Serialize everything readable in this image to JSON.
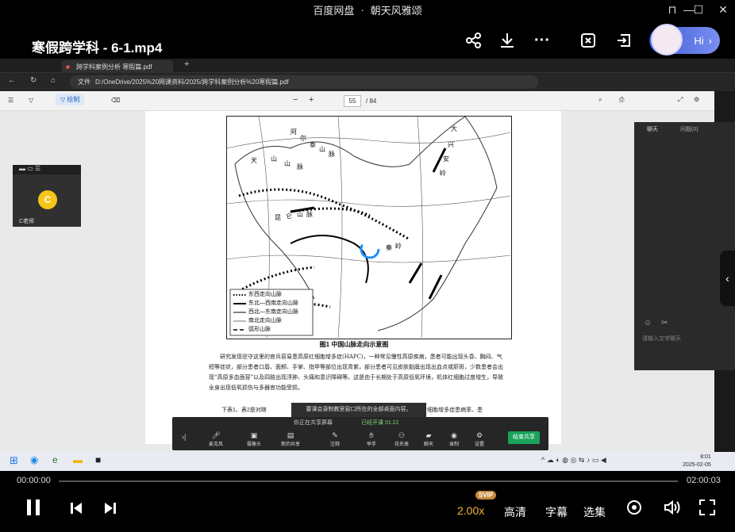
{
  "window": {
    "app_name": "百度网盘",
    "separator": "·",
    "channel": "朝天风雅颂"
  },
  "header": {
    "video_title": "寒假跨学科 - 6-1.mp4",
    "hi_label": "Hi"
  },
  "browser": {
    "tab_title": "跨学科案例分析 寒假篇.pdf",
    "file_label": "文件",
    "url": "D:/OneDrive/2025%20网课资料/2025/跨学科案例分析%20寒假篇.pdf"
  },
  "pdf_toolbar": {
    "draw_label": "绘制",
    "page_current": "55",
    "page_total": "/ 84"
  },
  "map": {
    "region_labels": [
      "天",
      "山",
      "山",
      "脉",
      "阿",
      "尔",
      "泰",
      "山",
      "脉",
      "昆",
      "仑",
      "山",
      "脉",
      "秦",
      "岭",
      "大",
      "兴",
      "安",
      "岭"
    ],
    "legend": [
      "东西走向山脉",
      "东北—西南走向山脉",
      "西北—东南走向山脉",
      "南北走向山脉",
      "弧形山脉"
    ],
    "caption": "图1 中国山脉走向示意图"
  },
  "document": {
    "para1": "研究发现驻守这里的官兵容易患高原红细胞增多症(HAPC)，一种常见慢性高原疾病，患者可能出现头昏、胸闷、气短等症状，部分患者口唇、面颊、手掌、指甲等部位出现青紫，部分患者可见皮肤黏膜出现出血点或瘀斑，少数患者会出现“高原多血面容”以及四肢出现浮肿、头痛和意识障碍等。这是由于长期处于高原低氧环境，机体红细胞过度增生，导致全身出现低氧损伤与多器官功能受损。",
    "para2_start": "下表1、表2是对喀",
    "para2_end": "细胞增多症患病率、患"
  },
  "chat": {
    "tab_chat": "聊天",
    "tab_questions": "问题(0)",
    "input_placeholder": "请输入文字聊天"
  },
  "camera": {
    "name": "C老师"
  },
  "meeting": {
    "notice": "要课会录制教室窗口所在的全部桌面内容。",
    "sharing": "你正在共享屏幕",
    "recording": "已经开课 01:22",
    "buttons": [
      "麦克风",
      "摄像头",
      "新的共享",
      "注释",
      "举手",
      "花名册",
      "聊天",
      "录制",
      "设置"
    ],
    "end_button": "结束共享"
  },
  "taskbar": {
    "time": "8:01",
    "date": "2025-02-05"
  },
  "player": {
    "current_time": "00:00:00",
    "total_time": "02:00:03",
    "speed": "2.00x",
    "speed_badge": "SVIP",
    "quality": "高清",
    "subtitle": "字幕",
    "episodes": "选集",
    "progress_fraction": 0.0
  }
}
